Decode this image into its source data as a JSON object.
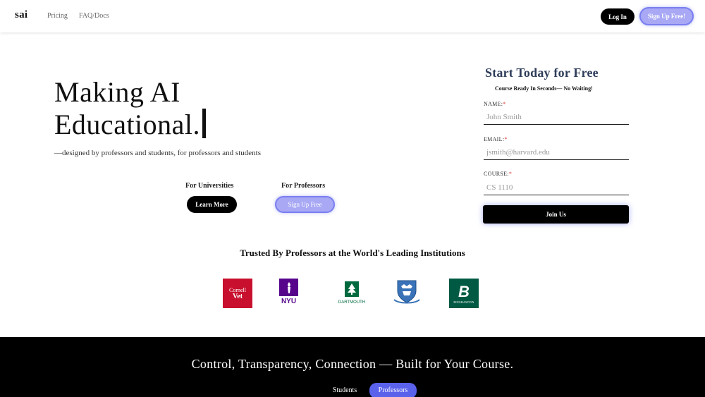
{
  "nav": {
    "logo": "sai",
    "links": [
      "Pricing",
      "FAQ/Docs"
    ],
    "login_label": "Log In",
    "signup_label": "Sign Up Free!"
  },
  "hero": {
    "title_line1": "Making AI",
    "title_line2": "Educational.",
    "subtitle": "—designed by professors and students, for professors and students",
    "universities_label": "For Universities",
    "learn_more_label": "Learn More",
    "professors_label": "For Professors",
    "signup_free_label": "Sign Up Free"
  },
  "form": {
    "title": "Start Today for Free",
    "subtitle": "Course Ready In Seconds— No Waiting!",
    "name_label": "NAME:",
    "name_placeholder": "John Smith",
    "email_label": "EMAIL:",
    "email_placeholder": "jsmith@harvard.edu",
    "course_label": "COURSE:",
    "course_placeholder": "CS 1110",
    "required_mark": "*",
    "submit_label": "Join Us"
  },
  "trusted": {
    "heading": "Trusted By Professors at the World's Leading Institutions",
    "logos": {
      "cornell_line1": "Cornell",
      "cornell_line2": "Vet",
      "nyu": "NYU",
      "dartmouth": "DARTMOUTH",
      "binghamton_letter": "B",
      "binghamton_name": "BINGHAMTON"
    }
  },
  "section": {
    "title": "Control, Transparency, Connection — Built for Your Course.",
    "tab_students": "Students",
    "tab_professors": "Professors"
  },
  "colors": {
    "accent": "#5a62ec",
    "form_title": "#2e3d5a",
    "cornell_red": "#c8102e",
    "nyu_purple": "#57068c",
    "dartmouth_green": "#00693e",
    "columbia_blue": "#3a73b8",
    "binghamton_green": "#005a43"
  }
}
